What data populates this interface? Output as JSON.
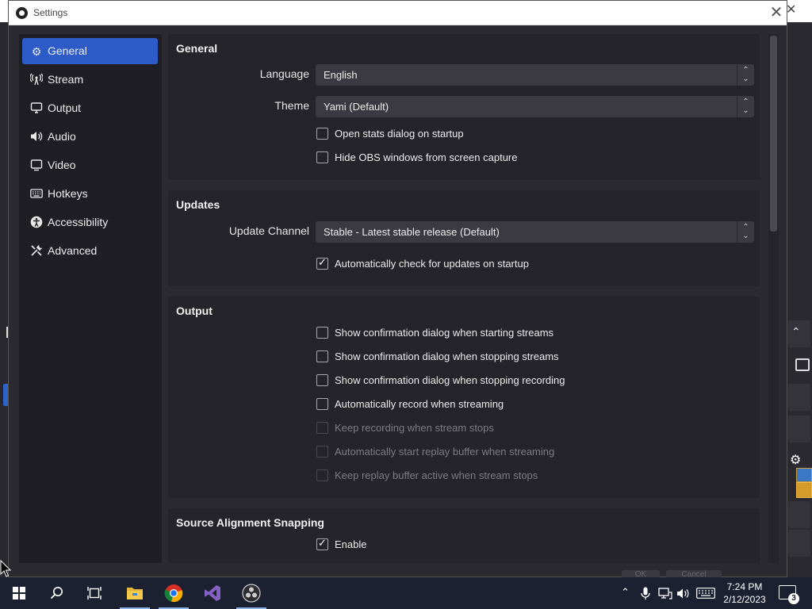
{
  "window": {
    "title": "Settings"
  },
  "sidebar": {
    "items": [
      {
        "label": "General",
        "icon": "gear-icon"
      },
      {
        "label": "Stream",
        "icon": "antenna-icon"
      },
      {
        "label": "Output",
        "icon": "output-icon"
      },
      {
        "label": "Audio",
        "icon": "speaker-icon"
      },
      {
        "label": "Video",
        "icon": "monitor-icon"
      },
      {
        "label": "Hotkeys",
        "icon": "keyboard-icon"
      },
      {
        "label": "Accessibility",
        "icon": "accessibility-icon"
      },
      {
        "label": "Advanced",
        "icon": "tools-icon"
      }
    ],
    "active": "General"
  },
  "general": {
    "title": "General",
    "language_label": "Language",
    "language_value": "English",
    "theme_label": "Theme",
    "theme_value": "Yami (Default)",
    "open_stats": {
      "label": "Open stats dialog on startup",
      "checked": false
    },
    "hide_obs": {
      "label": "Hide OBS windows from screen capture",
      "checked": false
    }
  },
  "updates": {
    "title": "Updates",
    "channel_label": "Update Channel",
    "channel_value": "Stable - Latest stable release (Default)",
    "auto_check": {
      "label": "Automatically check for updates on startup",
      "checked": true
    }
  },
  "output": {
    "title": "Output",
    "options": [
      {
        "label": "Show confirmation dialog when starting streams",
        "checked": false,
        "enabled": true
      },
      {
        "label": "Show confirmation dialog when stopping streams",
        "checked": false,
        "enabled": true
      },
      {
        "label": "Show confirmation dialog when stopping recording",
        "checked": false,
        "enabled": true
      },
      {
        "label": "Automatically record when streaming",
        "checked": false,
        "enabled": true
      },
      {
        "label": "Keep recording when stream stops",
        "checked": false,
        "enabled": false
      },
      {
        "label": "Automatically start replay buffer when streaming",
        "checked": false,
        "enabled": false
      },
      {
        "label": "Keep replay buffer active when stream stops",
        "checked": false,
        "enabled": false
      }
    ]
  },
  "snapping": {
    "title": "Source Alignment Snapping",
    "enable": {
      "label": "Enable",
      "checked": true
    }
  },
  "footer": {
    "ok_label": "OK",
    "cancel_label": "Cancel"
  },
  "taskbar": {
    "time": "7:24 PM",
    "date": "2/12/2023",
    "notification_count": "3",
    "accent": "#2d5cc8"
  }
}
